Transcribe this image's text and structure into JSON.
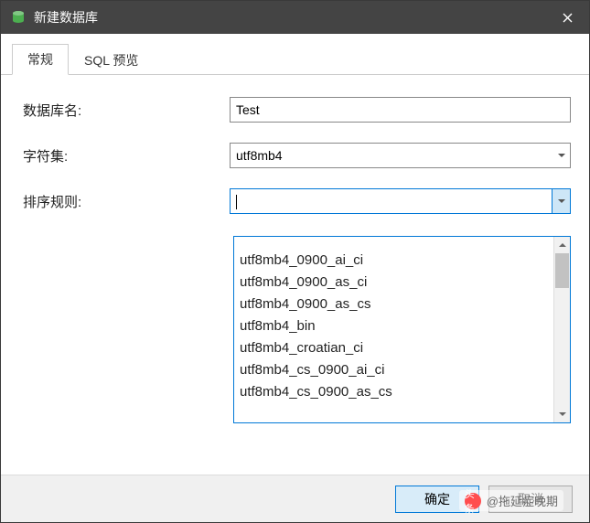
{
  "window": {
    "title": "新建数据库"
  },
  "tabs": {
    "general": "常规",
    "sql_preview": "SQL 预览"
  },
  "labels": {
    "db_name": "数据库名:",
    "charset": "字符集:",
    "collation": "排序规则:"
  },
  "values": {
    "db_name": "Test",
    "charset": "utf8mb4",
    "collation": ""
  },
  "collation_options": [
    "utf8mb4_0900_ai_ci",
    "utf8mb4_0900_as_ci",
    "utf8mb4_0900_as_cs",
    "utf8mb4_bin",
    "utf8mb4_croatian_ci",
    "utf8mb4_cs_0900_ai_ci",
    "utf8mb4_cs_0900_as_cs"
  ],
  "buttons": {
    "ok": "确定",
    "cancel": "取消"
  },
  "watermark": {
    "prefix": "头条",
    "text": "@拖延症晚期"
  }
}
